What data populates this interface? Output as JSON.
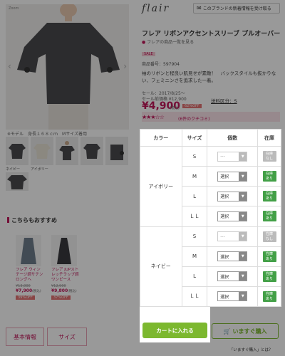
{
  "zoom_label": "Zoom",
  "model_caption": "※モデル　身長１６８ｃｍ　Mサイズ着用",
  "thumbs": {
    "first_label": "ネイビー",
    "second_label": "アイボリー"
  },
  "recommend_title": "こちらもおすすめ",
  "recommend_items": [
    {
      "name": "フレア ウィンテージ調サテンロングヘ",
      "old_price": "¥13,000",
      "price": "¥7,900",
      "tax": "(税込)",
      "off": "39%OFF"
    },
    {
      "name": "フレア JUPストレッチラップ調ワンピース",
      "old_price": "¥12,900",
      "price": "¥9,800",
      "tax": "(税込)",
      "off": "37%OFF"
    }
  ],
  "tabs": [
    "基本情報",
    "サイズ"
  ],
  "brand": "flair",
  "notify_label": "このブランドの新着情報を受け取る",
  "title": "フレア リボンアクセントスリーブ プルオーバー",
  "brand_link": "フレアの商品一覧を見る",
  "sale_badge": "SALE",
  "code": "商品番号：597904",
  "desc": "袖のリボンと程良い肌見せが素敵！　バックスタイルも抜かりない、フェミニンさを追求した一着。",
  "sale_date": "セール：2017/8/25〜",
  "sale_prev": "セール前価格 ¥12,900",
  "price": "¥4,900",
  "tax": "(税込)",
  "off": "62%OFF",
  "shipping": "送料区分：S",
  "reviews": "(6件のクチコミ)",
  "rating": 3.5,
  "table": {
    "headers": [
      "カラー",
      "サイズ",
      "個数",
      "在庫"
    ],
    "colors": [
      "アイボリー",
      "ネイビー"
    ],
    "rows": [
      {
        "size": "S",
        "select": "---",
        "stock": "在庫なし",
        "in_stock": false
      },
      {
        "size": "M",
        "select": "選択",
        "stock": "在庫あり",
        "in_stock": true
      },
      {
        "size": "L",
        "select": "選択",
        "stock": "在庫あり",
        "in_stock": true
      },
      {
        "size": "ＬＬ",
        "select": "選択",
        "stock": "在庫あり",
        "in_stock": true
      },
      {
        "size": "S",
        "select": "---",
        "stock": "在庫なし",
        "in_stock": false
      },
      {
        "size": "M",
        "select": "選択",
        "stock": "在庫あり",
        "in_stock": true
      },
      {
        "size": "L",
        "select": "選択",
        "stock": "在庫あり",
        "in_stock": true
      },
      {
        "size": "ＬＬ",
        "select": "選択",
        "stock": "在庫あり",
        "in_stock": true
      }
    ]
  },
  "cart_label": "カートに入れる",
  "ima_label": "いますぐ購入",
  "ima_link": "「いますぐ購入」とは？",
  "accent": "#c2185b",
  "green": "#7cb82f"
}
